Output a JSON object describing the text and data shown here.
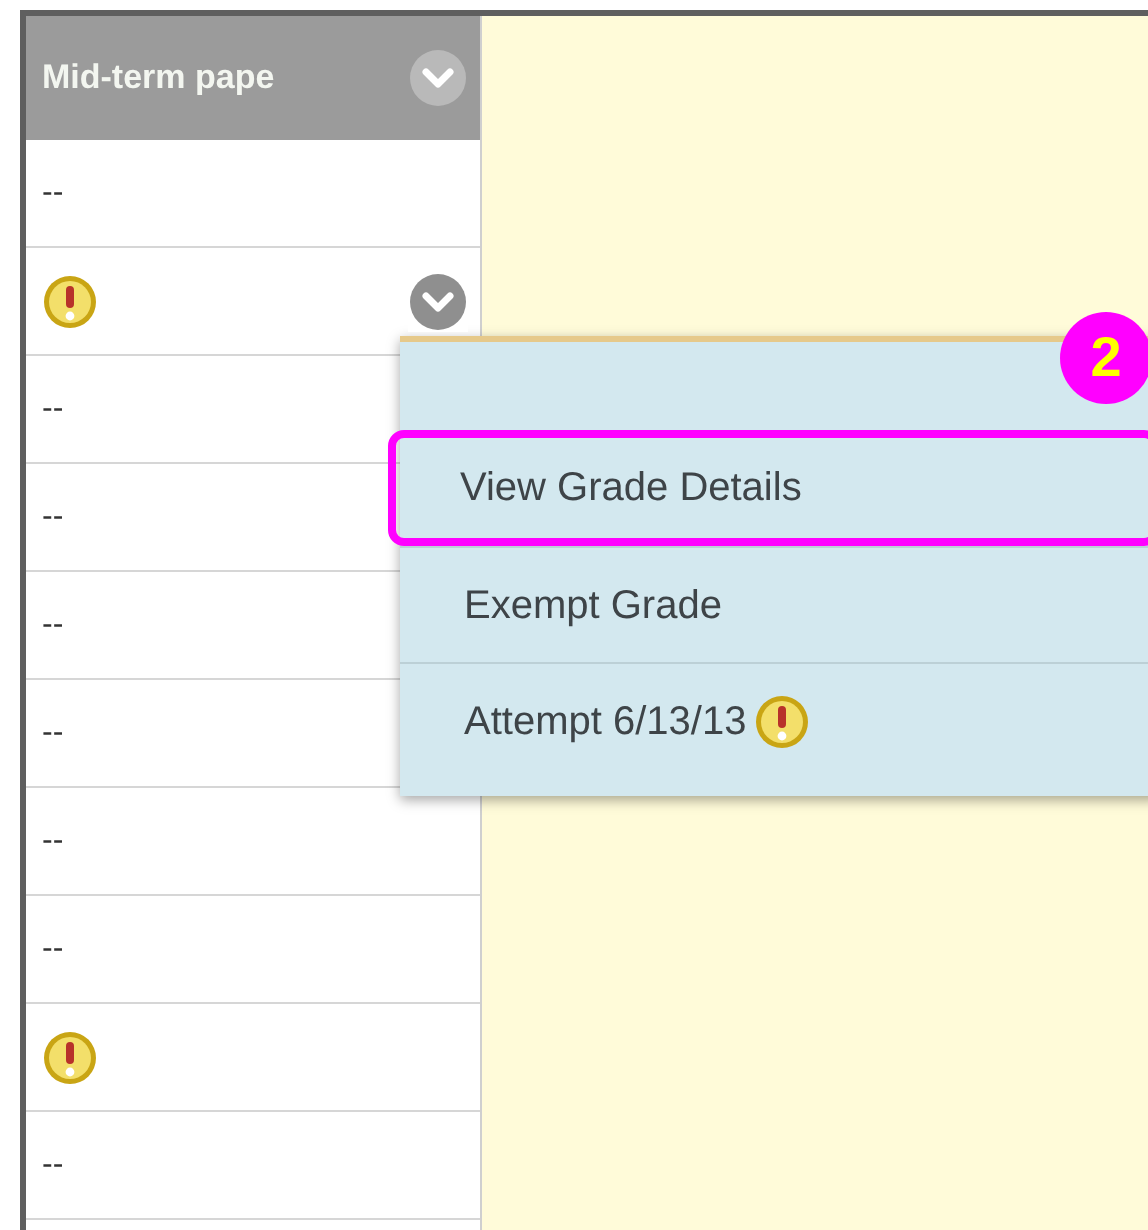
{
  "column": {
    "title": "Mid-term pape",
    "menu_button": true
  },
  "rows": [
    {
      "kind": "text",
      "text": "--",
      "menu_open": false
    },
    {
      "kind": "alert",
      "menu_open": true
    },
    {
      "kind": "text",
      "text": "--",
      "menu_open": false
    },
    {
      "kind": "text",
      "text": "--",
      "menu_open": false
    },
    {
      "kind": "text",
      "text": "--",
      "menu_open": false
    },
    {
      "kind": "text",
      "text": "--",
      "menu_open": false
    },
    {
      "kind": "text",
      "text": "--",
      "menu_open": false
    },
    {
      "kind": "text",
      "text": "--",
      "menu_open": false
    },
    {
      "kind": "alert",
      "menu_open": false
    },
    {
      "kind": "text",
      "text": "--",
      "menu_open": false
    }
  ],
  "menu": {
    "callout": "2",
    "items": [
      {
        "kind": "text",
        "label": "View Grade Details",
        "selected": true
      },
      {
        "kind": "text",
        "label": "Exempt Grade",
        "selected": false
      },
      {
        "kind": "alert",
        "label": "Attempt 6/13/13",
        "selected": false
      }
    ]
  }
}
